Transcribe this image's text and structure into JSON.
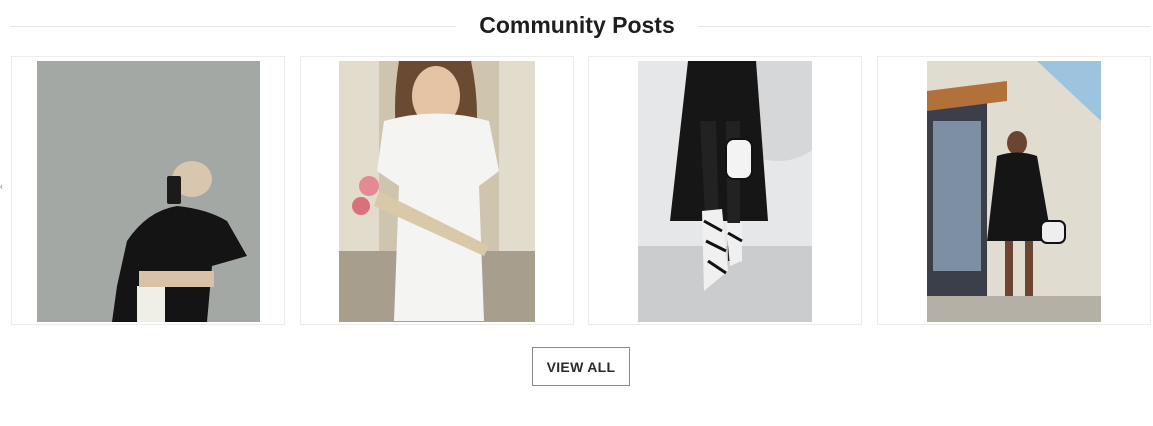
{
  "section": {
    "title": "Community Posts",
    "view_all_label": "VIEW ALL"
  },
  "posts": [
    {
      "subject": "woman in black outfit taking mirror selfie",
      "palette": {
        "bg": "#a9adaa",
        "figure": "#141414"
      }
    },
    {
      "subject": "woman in white dress holding bouquet of roses",
      "palette": {
        "bg": "#b9ab92",
        "figure": "#f4f4f2"
      }
    },
    {
      "subject": "black coat, zebra-print boots and bag",
      "palette": {
        "bg": "#e3e4e5",
        "figure": "#181818"
      }
    },
    {
      "subject": "woman in black dress with zebra bag by building",
      "palette": {
        "bg": "#8fb3c9",
        "figure": "#151515"
      }
    }
  ],
  "colors": {
    "title": "#1e1e1e",
    "rule": "#e6e6e6",
    "button_border": "#8a8a8a"
  }
}
